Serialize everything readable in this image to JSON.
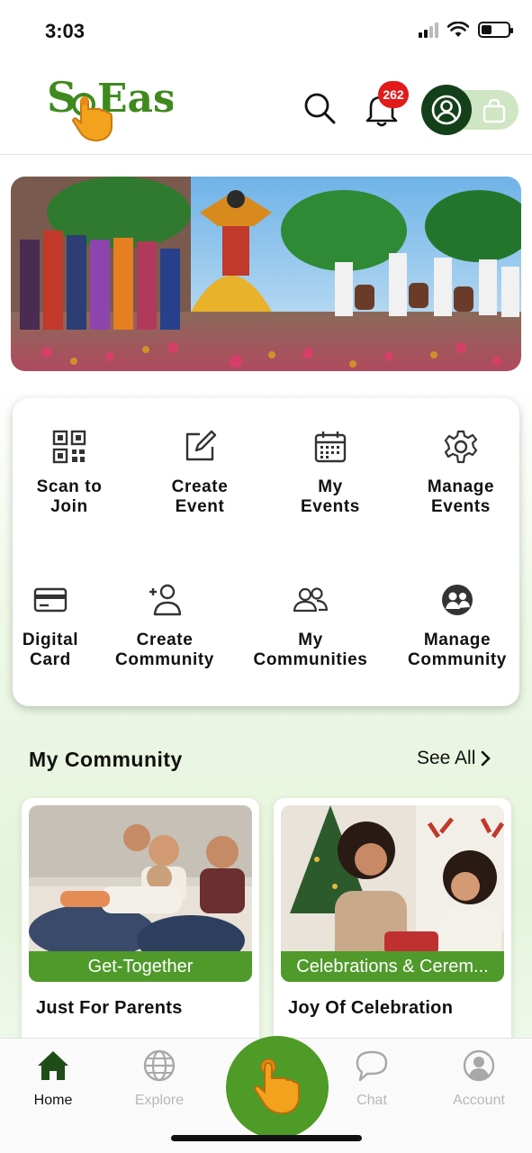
{
  "status_bar": {
    "time": "3:03"
  },
  "header": {
    "logo_text": "SoEasy",
    "notification_count": "262"
  },
  "actions": [
    {
      "label": "Scan to\nJoin",
      "icon": "qr-code-icon"
    },
    {
      "label": "Create\nEvent",
      "icon": "edit-icon"
    },
    {
      "label": "My\nEvents",
      "icon": "calendar-icon"
    },
    {
      "label": "Manage\nEvents",
      "icon": "gear-icon"
    },
    {
      "label": "Digital\nCard",
      "icon": "card-icon"
    },
    {
      "label": "Create\nCommunity",
      "icon": "add-user-icon"
    },
    {
      "label": "My\nCommunities",
      "icon": "users-icon"
    },
    {
      "label": "Manage\nCommunity",
      "icon": "community-icon"
    }
  ],
  "community_section": {
    "title": "My Community",
    "see_all": "See All",
    "cards": [
      {
        "tag": "Get-Together",
        "name": "Just For Parents"
      },
      {
        "tag": "Celebrations & Cerem...",
        "name": "Joy Of Celebration"
      }
    ]
  },
  "bottom_nav": {
    "items": [
      {
        "label": "Home",
        "icon": "home-icon",
        "active": true
      },
      {
        "label": "Explore",
        "icon": "globe-icon",
        "active": false
      },
      {
        "label": "Chat",
        "icon": "chat-icon",
        "active": false
      },
      {
        "label": "Account",
        "icon": "account-icon",
        "active": false
      }
    ]
  },
  "colors": {
    "brand_green": "#4e9b28",
    "dark_green": "#13401a",
    "badge_red": "#e11b1b",
    "hand_orange": "#f2a21c"
  }
}
